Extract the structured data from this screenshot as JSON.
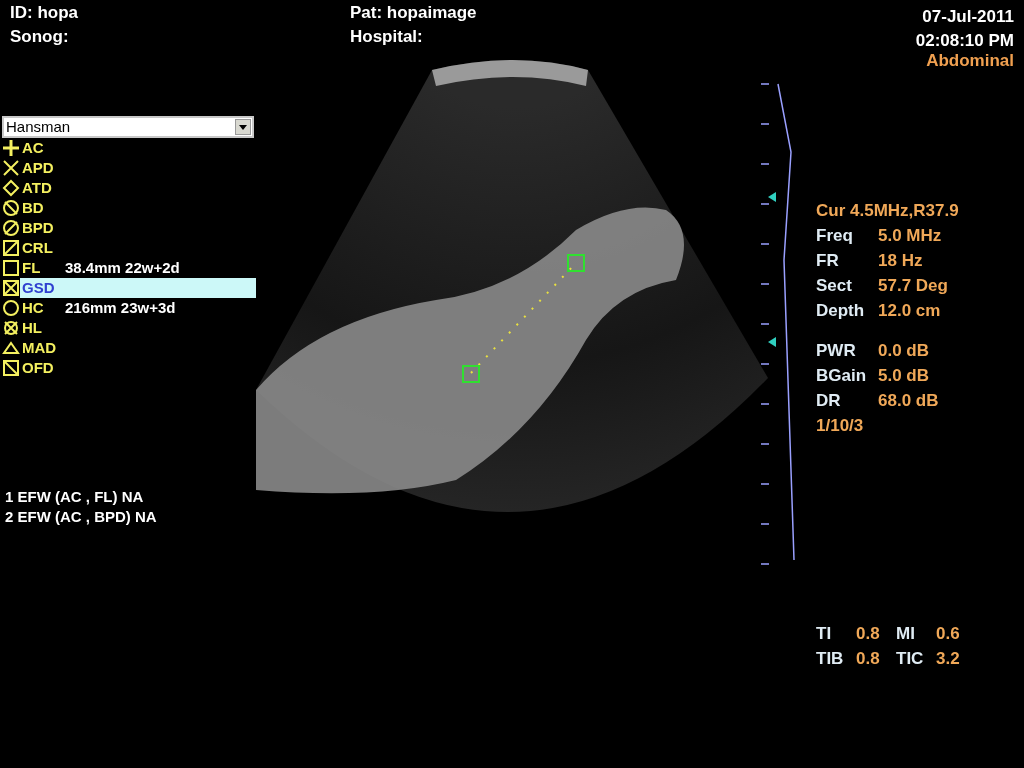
{
  "header": {
    "id": "ID: hopa",
    "sonographer": "Sonog:",
    "patient": "Pat: hopaimage",
    "hospital": "Hospital:",
    "date": "07-Jul-2011",
    "time": "02:08:10 PM",
    "exam": "Abdominal"
  },
  "table_select": {
    "value": "Hansman"
  },
  "measurements": [
    {
      "label": "AC",
      "kind": "plus",
      "selected": false
    },
    {
      "label": "APD",
      "kind": "cross",
      "selected": false
    },
    {
      "label": "ATD",
      "kind": "diamond",
      "selected": false
    },
    {
      "label": "BD",
      "kind": "circleslash",
      "selected": false
    },
    {
      "label": "BPD",
      "kind": "circlebackslash",
      "selected": false
    },
    {
      "label": "CRL",
      "kind": "squareslash",
      "selected": false
    },
    {
      "label": "FL",
      "kind": "square",
      "selected": false,
      "value": "38.4mm 22w+2d"
    },
    {
      "label": "GSD",
      "kind": "squarex",
      "selected": true
    },
    {
      "label": "HC",
      "kind": "circle",
      "selected": false,
      "value": "216mm 23w+3d"
    },
    {
      "label": "HL",
      "kind": "circlex",
      "selected": false
    },
    {
      "label": "MAD",
      "kind": "triangle",
      "selected": false
    },
    {
      "label": "OFD",
      "kind": "squarebackslash",
      "selected": false
    }
  ],
  "efw": [
    "1 EFW (AC , FL)  NA",
    "2 EFW (AC , BPD)  NA"
  ],
  "probe": "Cur 4.5MHz,R37.9",
  "imaging_params": [
    {
      "label": "Freq",
      "value": "5.0 MHz"
    },
    {
      "label": "FR",
      "value": "18 Hz"
    },
    {
      "label": "Sect",
      "value": "57.7 Deg"
    },
    {
      "label": "Depth",
      "value": "12.0 cm"
    }
  ],
  "gain_params": [
    {
      "label": "PWR",
      "value": "0.0 dB"
    },
    {
      "label": "BGain",
      "value": "5.0 dB"
    },
    {
      "label": "DR",
      "value": "68.0 dB"
    }
  ],
  "preset": "1/10/3",
  "indices": [
    {
      "label": "TI",
      "value": "0.8"
    },
    {
      "label": "MI",
      "value": "0.6"
    },
    {
      "label": "TIB",
      "value": "0.8"
    },
    {
      "label": "TIC",
      "value": "3.2"
    }
  ]
}
